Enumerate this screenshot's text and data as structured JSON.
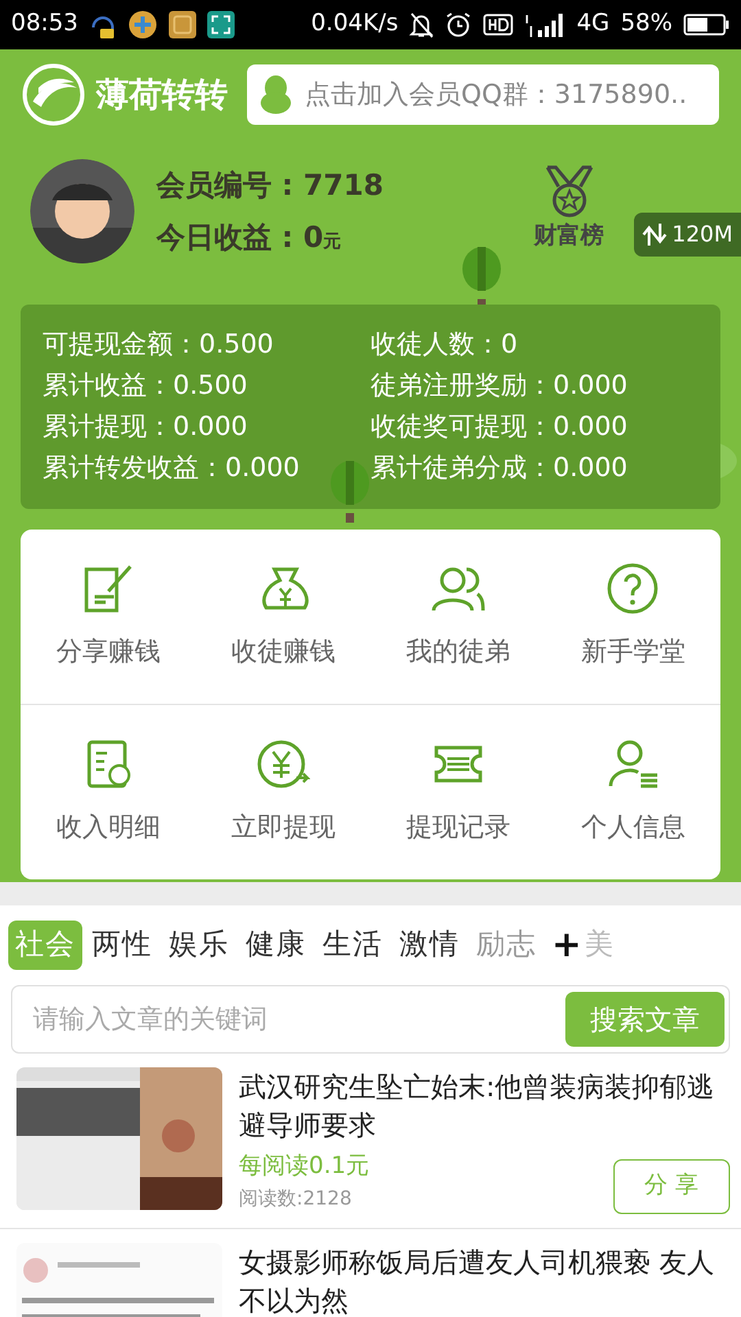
{
  "status_bar": {
    "time": "08:53",
    "speed": "0.04K/s",
    "network": "4G",
    "battery": "58%"
  },
  "header": {
    "logo_text": "薄荷转转",
    "qq_prompt": "点击加入会员QQ群：3175890.."
  },
  "profile": {
    "member_label": "会员编号 :",
    "member_no": "7718",
    "today_label": "今日收益 :",
    "today_value": "0",
    "today_unit": "元",
    "ranking_label": "财富榜",
    "float_speed": "120M"
  },
  "stats": [
    {
      "label": "可提现金额：",
      "value": "0.500"
    },
    {
      "label": "收徒人数：",
      "value": "0"
    },
    {
      "label": "累计收益：",
      "value": "0.500"
    },
    {
      "label": "徒弟注册奖励：",
      "value": "0.000"
    },
    {
      "label": "累计提现：",
      "value": "0.000"
    },
    {
      "label": "收徒奖可提现：",
      "value": "0.000"
    },
    {
      "label": "累计转发收益：",
      "value": "0.000"
    },
    {
      "label": "累计徒弟分成：",
      "value": "0.000"
    }
  ],
  "menu": [
    {
      "label": "分享赚钱"
    },
    {
      "label": "收徒赚钱"
    },
    {
      "label": "我的徒弟"
    },
    {
      "label": "新手学堂"
    },
    {
      "label": "收入明细"
    },
    {
      "label": "立即提现"
    },
    {
      "label": "提现记录"
    },
    {
      "label": "个人信息"
    }
  ],
  "tabs": [
    {
      "label": "社会",
      "selected": true
    },
    {
      "label": "两性",
      "selected": false
    },
    {
      "label": "娱乐",
      "selected": false
    },
    {
      "label": "健康",
      "selected": false
    },
    {
      "label": "生活",
      "selected": false
    },
    {
      "label": "激情",
      "selected": false
    },
    {
      "label": "励志",
      "selected": false
    }
  ],
  "tab_add": "+",
  "tab_next": "美",
  "search": {
    "placeholder": "请输入文章的关键词",
    "button": "搜索文章"
  },
  "articles": [
    {
      "title": "武汉研究生坠亡始末:他曾装病装抑郁逃避导师要求",
      "reward": "每阅读0.1元",
      "reads": "阅读数:2128",
      "share": "分 享"
    },
    {
      "title": "女摄影师称饭局后遭友人司机猥亵 友人不以为然"
    }
  ]
}
